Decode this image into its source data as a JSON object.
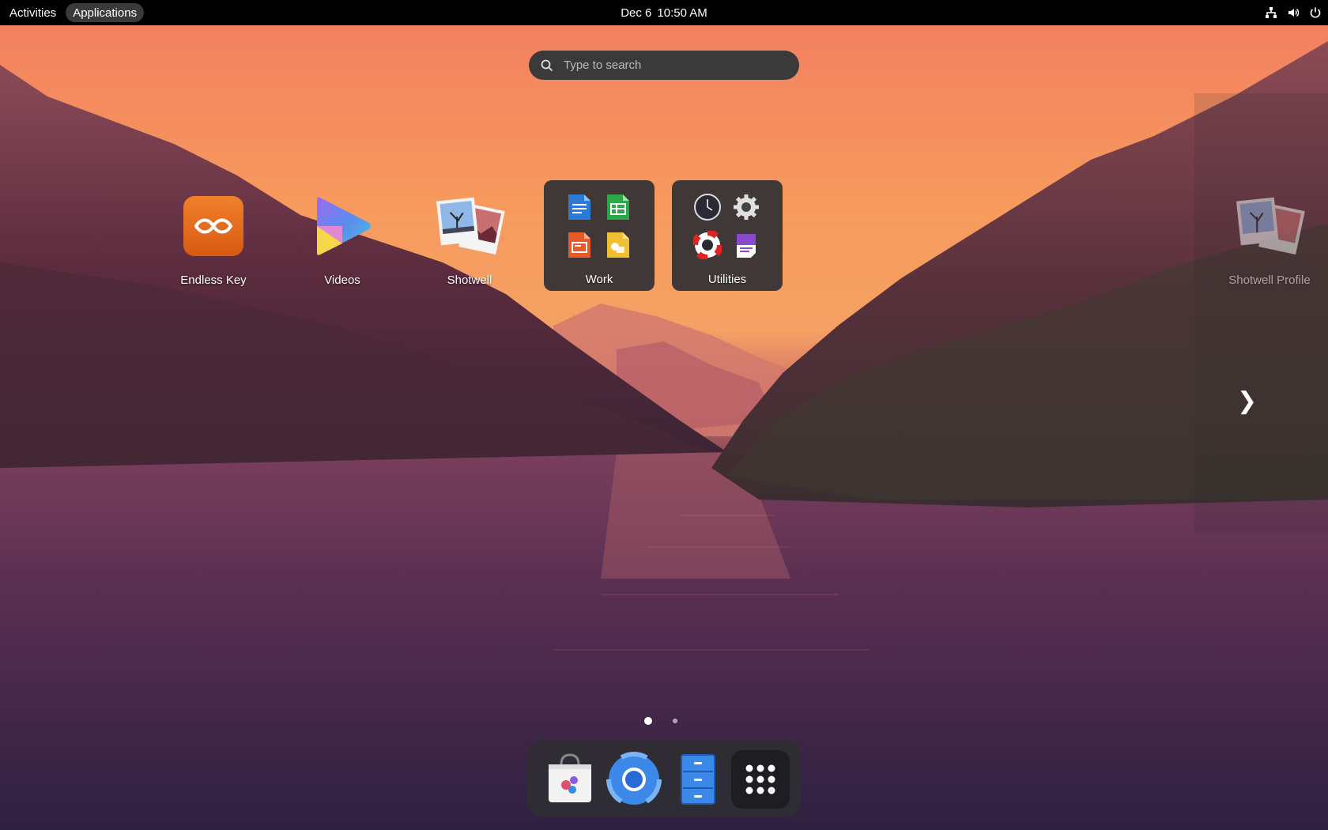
{
  "topbar": {
    "activities_label": "Activities",
    "applications_label": "Applications",
    "date": "Dec 6",
    "time": "10:50 AM"
  },
  "search": {
    "placeholder": "Type to search"
  },
  "apps": [
    {
      "label": "Endless Key",
      "icon": "endless-key-icon"
    },
    {
      "label": "Videos",
      "icon": "videos-icon"
    },
    {
      "label": "Shotwell",
      "icon": "shotwell-icon"
    }
  ],
  "folders": [
    {
      "label": "Work",
      "icons": [
        "writer-icon",
        "calc-icon",
        "impress-icon",
        "draw-icon"
      ]
    },
    {
      "label": "Utilities",
      "icons": [
        "clock-icon",
        "settings-icon",
        "help-icon",
        "text-editor-icon"
      ]
    }
  ],
  "next_page_app": {
    "label": "Shotwell Profile"
  },
  "pages": {
    "current": 1,
    "total": 2
  },
  "dock": [
    "software-store-icon",
    "chromium-icon",
    "file-manager-icon",
    "show-apps-icon"
  ],
  "colors": {
    "topbar_bg": "#000000",
    "search_bg": "#3a3a3a",
    "folder_bg": "#303034",
    "dock_bg": "#2d2d32"
  }
}
